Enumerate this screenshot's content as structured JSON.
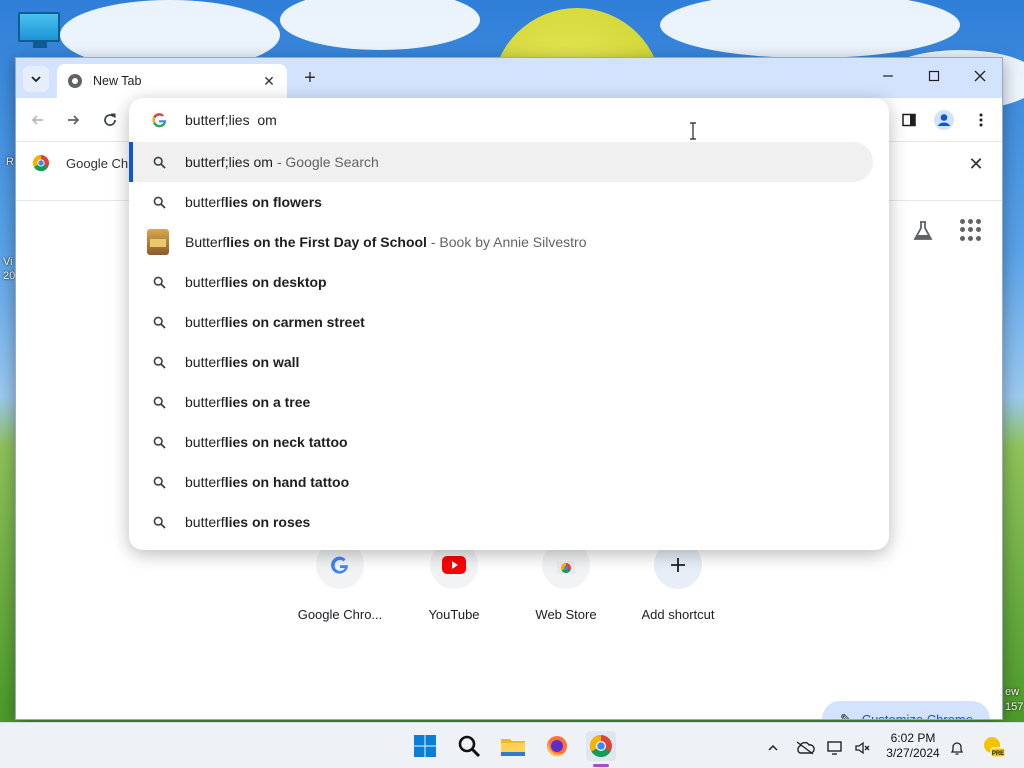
{
  "browser": {
    "tab_title": "New Tab",
    "new_tab_symbol": "+",
    "close_symbol": "✕",
    "window": {
      "minimize": "—",
      "maximize": "☐",
      "close": "✕"
    }
  },
  "bookmark_bar": {
    "item_label": "Google Ch",
    "close_symbol": "✕"
  },
  "omnibox": {
    "input_value": "butterf;lies  om",
    "suggestions": [
      {
        "prefix": "butterf;lies om",
        "suffix": "",
        "separator": " - ",
        "description": "Google Search",
        "icon": "search-icon",
        "selected": true
      },
      {
        "prefix": "butterf",
        "suffix": "lies on flowers",
        "icon": "search-icon"
      },
      {
        "prefix": "Butterf",
        "suffix": "lies on the First Day of School",
        "separator": " - ",
        "description": "Book by Annie Silvestro",
        "icon": "book-thumbnail"
      },
      {
        "prefix": "butterf",
        "suffix": "lies on desktop",
        "icon": "search-icon"
      },
      {
        "prefix": "butterf",
        "suffix": "lies on carmen street",
        "icon": "search-icon"
      },
      {
        "prefix": "butterf",
        "suffix": "lies on wall",
        "icon": "search-icon"
      },
      {
        "prefix": "butterf",
        "suffix": "lies on a tree",
        "icon": "search-icon"
      },
      {
        "prefix": "butterf",
        "suffix": "lies on neck tattoo",
        "icon": "search-icon"
      },
      {
        "prefix": "butterf",
        "suffix": "lies on hand tattoo",
        "icon": "search-icon"
      },
      {
        "prefix": "butterf",
        "suffix": "lies on roses",
        "icon": "search-icon"
      }
    ]
  },
  "shortcuts": [
    {
      "label": "Google Chro...",
      "icon": "google-icon"
    },
    {
      "label": "YouTube",
      "icon": "youtube-icon"
    },
    {
      "label": "Web Store",
      "icon": "web-store-icon"
    },
    {
      "label": "Add shortcut",
      "icon": "plus-icon"
    }
  ],
  "customize_label": "Customize Chrome",
  "desktop_fragments": {
    "left_r": "R",
    "left_v": "Vi",
    "left_2": "20",
    "right_ew": "ew",
    "right_157": "157"
  },
  "taskbar": {
    "time": "6:02 PM",
    "date": "3/27/2024",
    "weather_badge": "PRE"
  },
  "colors": {
    "accent": "#0b57d0",
    "tab_strip": "#d3e3fd",
    "selected_row": "#f0f0f0",
    "taskbar": "#eef2f7"
  }
}
